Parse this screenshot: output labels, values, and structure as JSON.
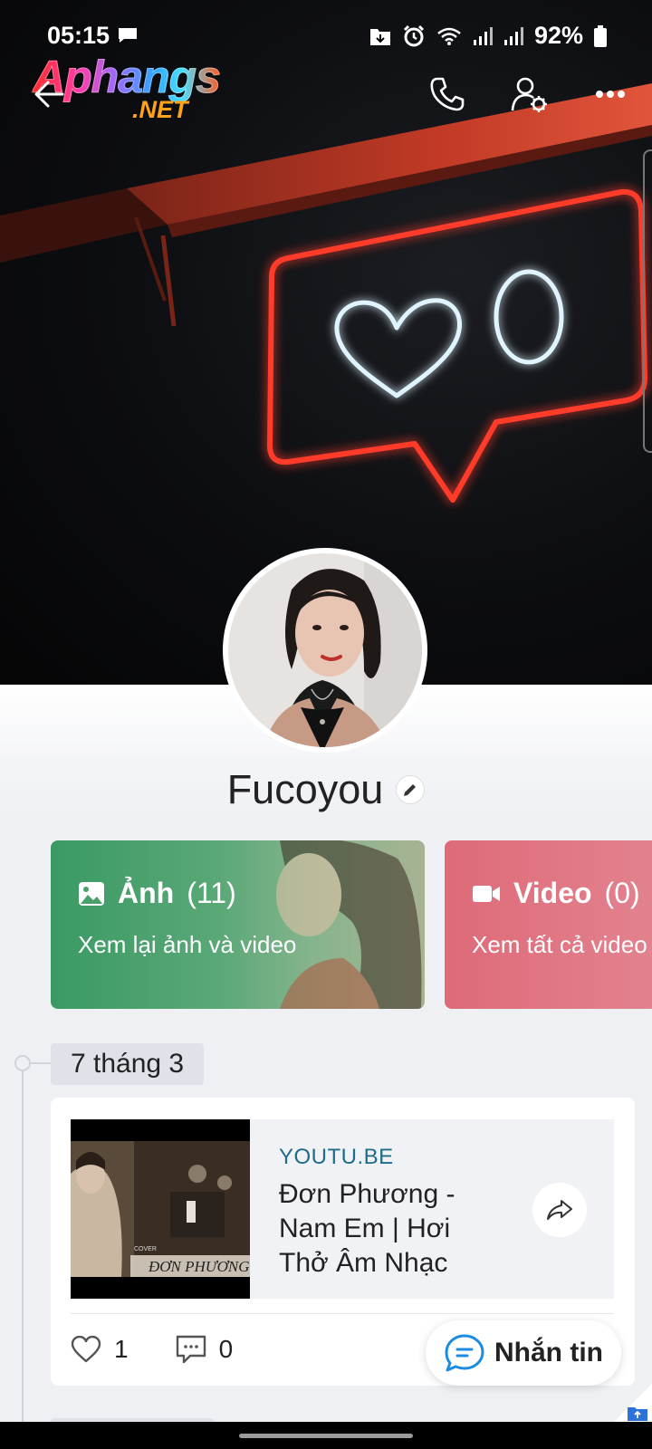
{
  "status_bar": {
    "time": "05:15",
    "battery": "92%",
    "icons": [
      "message-icon",
      "download-icon",
      "alarm-icon",
      "wifi-icon",
      "signal-icon",
      "signal-icon",
      "battery-icon"
    ]
  },
  "watermark": {
    "main": "Aphangs",
    "sub": ".NET"
  },
  "toolbar": {
    "icons": [
      "back-arrow-icon",
      "phone-icon",
      "user-settings-icon",
      "more-icon"
    ]
  },
  "profile": {
    "name": "Fucoyou"
  },
  "media_cards": {
    "photos": {
      "title": "Ảnh",
      "count": "(11)",
      "subtitle": "Xem lại ảnh và video",
      "color": "#3a9a63"
    },
    "videos": {
      "title": "Video",
      "count": "(0)",
      "subtitle": "Xem tất cả video",
      "color": "#de6a78"
    }
  },
  "timeline": {
    "date": "7 tháng 3",
    "post": {
      "link_domain": "YOUTU.BE",
      "link_title": "Đơn Phương - Nam Em | Hơi Thở Âm Nhạc",
      "thumb_caption": "ĐƠN PHƯƠNG",
      "thumb_small": "COVER",
      "likes": "1",
      "comments": "0"
    }
  },
  "fab": {
    "label": "Nhắn tin"
  },
  "colors": {
    "accent_blue": "#1d8ce0",
    "neon_red": "#ff3a2a",
    "neon_white": "#dff4ff"
  }
}
